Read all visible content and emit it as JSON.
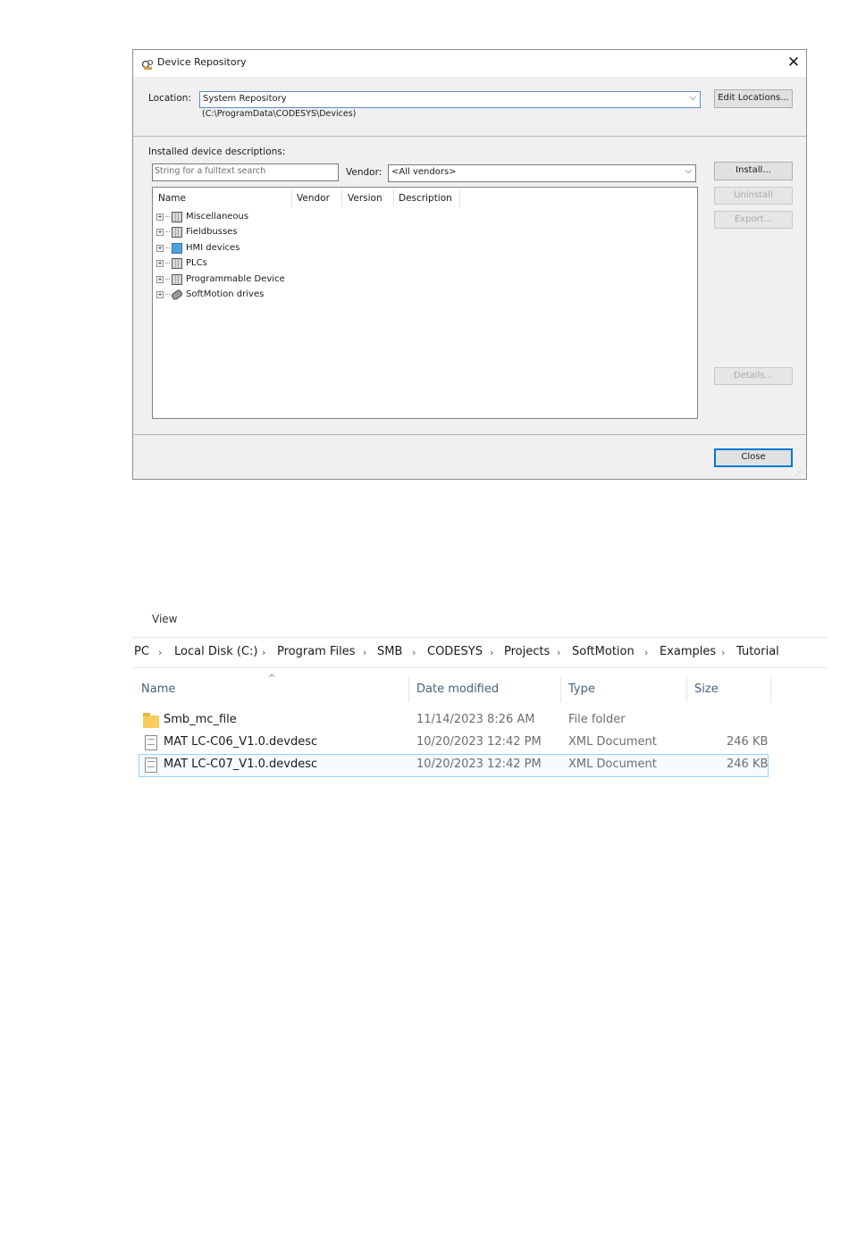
{
  "dialog": {
    "title": "Device Repository",
    "location_label": "Location:",
    "location_value": "System Repository",
    "location_path": "(C:\\ProgramData\\CODESYS\\Devices)",
    "edit_locations_label": "Edit Locations...",
    "installed_label": "Installed device descriptions:",
    "search_placeholder": "String for a fulltext search",
    "vendor_label": "Vendor:",
    "vendor_value": "<All vendors>",
    "buttons": {
      "install": "Install...",
      "uninstall": "Uninstall",
      "export": "Export...",
      "details": "Details...",
      "close": "Close"
    },
    "columns": [
      "Name",
      "Vendor",
      "Version",
      "Description"
    ],
    "tree": [
      {
        "label": "Miscellaneous",
        "icon": "device-icon"
      },
      {
        "label": "Fieldbusses",
        "icon": "device-icon"
      },
      {
        "label": "HMI devices",
        "icon": "monitor-icon"
      },
      {
        "label": "PLCs",
        "icon": "device-icon"
      },
      {
        "label": "Programmable Device",
        "icon": "device-icon"
      },
      {
        "label": "SoftMotion drives",
        "icon": "drive-icon"
      }
    ]
  },
  "explorer": {
    "menu_view": "View",
    "breadcrumb": [
      "PC",
      "Local Disk (C:)",
      "Program Files",
      "SMB",
      "CODESYS",
      "Projects",
      "SoftMotion",
      "Examples",
      "Tutorial"
    ],
    "columns": [
      "Name",
      "Date modified",
      "Type",
      "Size"
    ],
    "rows": [
      {
        "name": "Smb_mc_file",
        "date": "11/14/2023 8:26 AM",
        "type": "File folder",
        "size": "",
        "icon": "folder-icon"
      },
      {
        "name": "MAT LC-C06_V1.0.devdesc",
        "date": "10/20/2023 12:42 PM",
        "type": "XML Document",
        "size": "246 KB",
        "icon": "xml-file-icon"
      },
      {
        "name": "MAT LC-C07_V1.0.devdesc",
        "date": "10/20/2023 12:42 PM",
        "type": "XML Document",
        "size": "246 KB",
        "icon": "xml-file-icon"
      }
    ]
  }
}
